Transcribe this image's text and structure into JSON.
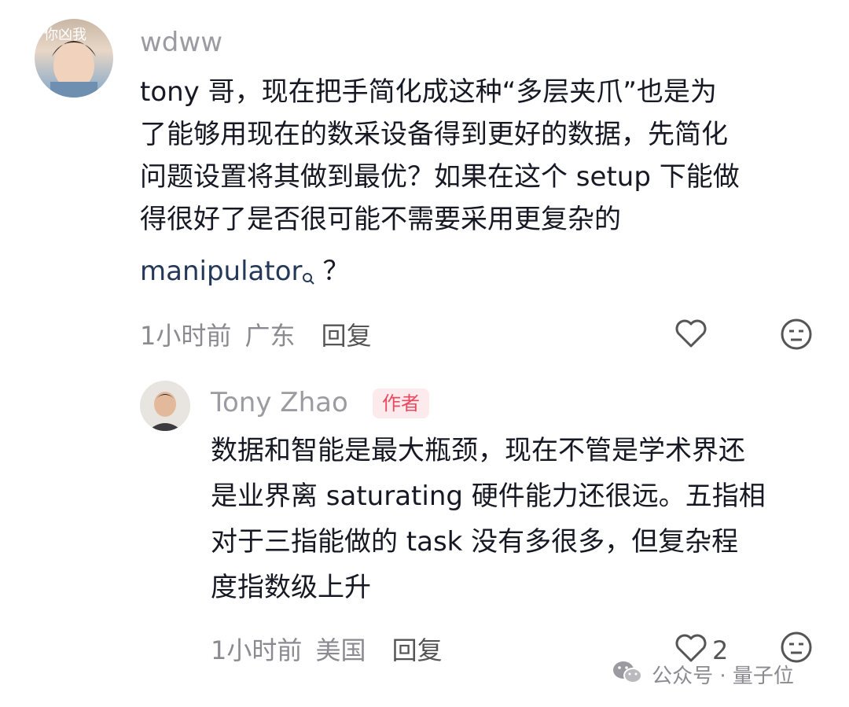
{
  "comment": {
    "username": "wdww",
    "avatar_text": "你凶我",
    "lines": [
      "tony 哥，现在把手简化成这种“多层夹爪”也是为",
      "了能够用现在的数采设备得到更好的数据，先简化",
      "问题设置将其做到最优？如果在这个 setup 下能做",
      "得很好了是否很可能不需要采用更复杂的"
    ],
    "link_text": "manipulator",
    "tail_text": "？",
    "time": "1小时前",
    "location": "广东",
    "reply_label": "回复"
  },
  "reply": {
    "username": "Tony Zhao",
    "badge": "作者",
    "lines": [
      "数据和智能是最大瓶颈，现在不管是学术界还",
      "是业界离 saturating 硬件能力还很远。五指相",
      "对于三指能做的 task 没有多很多，但复杂程",
      "度指数级上升"
    ],
    "time": "1小时前",
    "location": "美国",
    "reply_label": "回复",
    "like_count": "2"
  },
  "watermark": {
    "text": "公众号 · 量子位"
  },
  "icons": [
    "heart-icon",
    "dislike-face-icon",
    "search-icon",
    "wechat-icon"
  ]
}
